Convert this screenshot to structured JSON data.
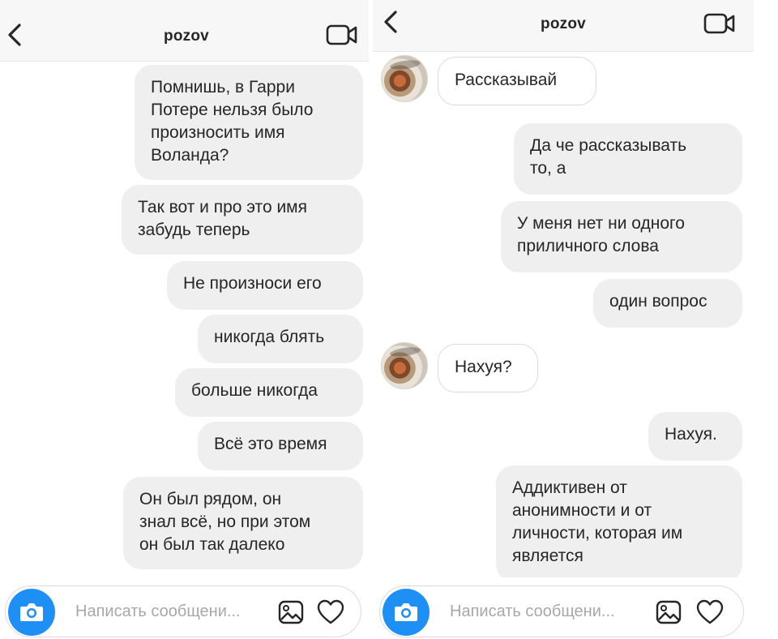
{
  "colors": {
    "accent": "#1e90f5",
    "bubble_out": "#efefef",
    "bubble_in_border": "#dbdbdb",
    "header_bg": "#f7f7f7"
  },
  "left": {
    "header": {
      "title": "pozov",
      "back_icon": "chevron-left-icon",
      "video_icon": "video-camera-icon"
    },
    "messages": [
      {
        "direction": "outgoing",
        "lines": [
          "Помнишь, в Гарри",
          "Потере нельзя было",
          "произносить имя",
          "Воланда?"
        ]
      },
      {
        "direction": "outgoing",
        "lines": [
          "Так вот и про это имя",
          "забудь теперь"
        ]
      },
      {
        "direction": "outgoing",
        "lines": [
          "Не произноси его"
        ]
      },
      {
        "direction": "outgoing",
        "lines": [
          "никогда блять"
        ]
      },
      {
        "direction": "outgoing",
        "lines": [
          "больше никогда"
        ]
      },
      {
        "direction": "outgoing",
        "lines": [
          "Всё это время"
        ]
      },
      {
        "direction": "outgoing",
        "lines": [
          "Он был рядом, он",
          "знал всё, но при этом",
          "он был так далеко"
        ]
      }
    ],
    "composer": {
      "placeholder": "Написать сообщени...",
      "camera_icon": "camera-icon",
      "gallery_icon": "gallery-icon",
      "heart_icon": "heart-icon"
    }
  },
  "right": {
    "header": {
      "title": "pozov",
      "back_icon": "chevron-left-icon",
      "video_icon": "video-camera-icon"
    },
    "messages": [
      {
        "direction": "incoming",
        "lines": [
          "Рассказывай"
        ]
      },
      {
        "direction": "outgoing",
        "lines": [
          "Да че рассказывать",
          "то, а"
        ]
      },
      {
        "direction": "outgoing",
        "lines": [
          "У меня нет ни одного",
          "приличного слова"
        ]
      },
      {
        "direction": "outgoing",
        "lines": [
          "один вопрос"
        ]
      },
      {
        "direction": "incoming",
        "lines": [
          "Нахуя?"
        ]
      },
      {
        "direction": "outgoing",
        "lines": [
          "Нахуя."
        ]
      },
      {
        "direction": "outgoing",
        "lines": [
          "Аддиктивен от",
          "анонимности и от",
          "личности, которая им",
          "является"
        ]
      }
    ],
    "composer": {
      "placeholder": "Написать сообщени...",
      "camera_icon": "camera-icon",
      "gallery_icon": "gallery-icon",
      "heart_icon": "heart-icon"
    }
  }
}
